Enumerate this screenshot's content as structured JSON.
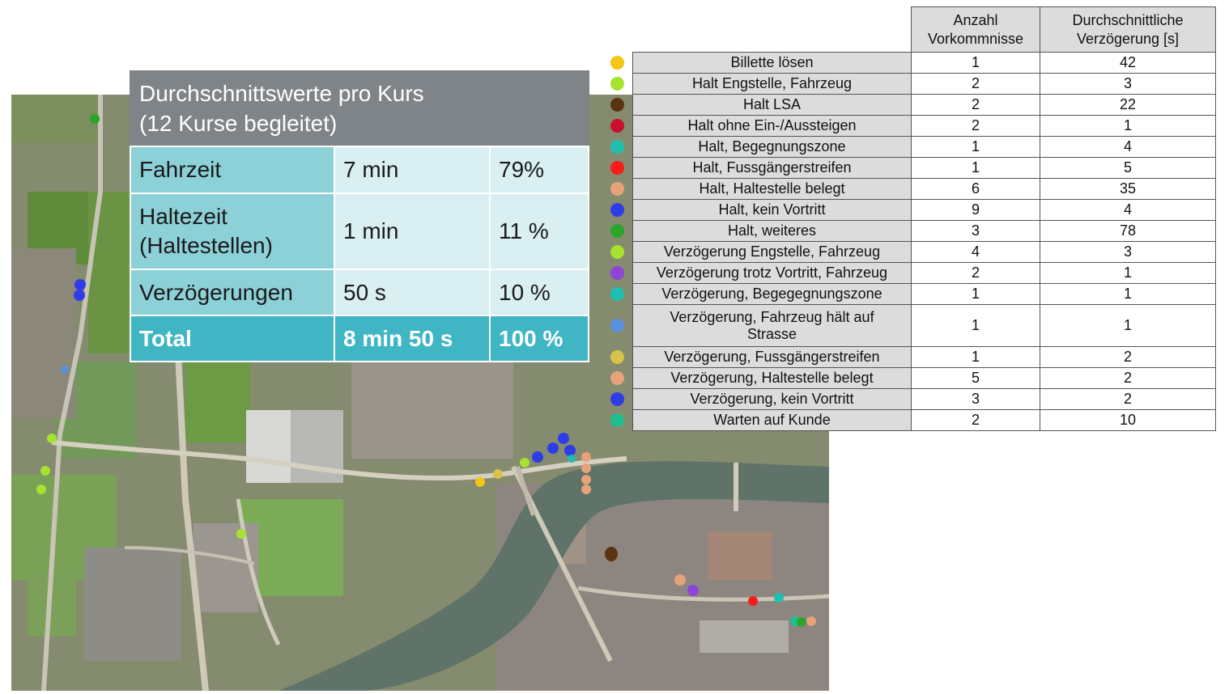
{
  "summary": {
    "title_line1": "Durchschnittswerte pro Kurs",
    "title_line2": "(12 Kurse begleitet)",
    "rows": [
      {
        "label": "Fahrzeit",
        "time": "7 min",
        "share": "79%"
      },
      {
        "label_line1": "Haltezeit",
        "label_line2": "(Haltestellen)",
        "time": "1 min",
        "share": "11 %"
      },
      {
        "label": "Verzögerungen",
        "time": "50 s",
        "share": "10 %"
      }
    ],
    "total": {
      "label": "Total",
      "time": "8 min 50 s",
      "share": "100 %"
    }
  },
  "incident_table": {
    "header_count_line1": "Anzahl",
    "header_count_line2": "Vorkommnisse",
    "header_delay_line1": "Durchschnittliche",
    "header_delay_line2": "Verzögerung [s]",
    "rows": [
      {
        "name": "Billette lösen",
        "count": "1",
        "delay": "42",
        "color": "#f5c518"
      },
      {
        "name": "Halt Engstelle, Fahrzeug",
        "count": "2",
        "delay": "3",
        "color": "#a6e22e"
      },
      {
        "name": "Halt LSA",
        "count": "2",
        "delay": "22",
        "color": "#5c3310"
      },
      {
        "name": "Halt ohne Ein-/Aussteigen",
        "count": "2",
        "delay": "1",
        "color": "#c8102e"
      },
      {
        "name": "Halt, Begegnungszone",
        "count": "1",
        "delay": "4",
        "color": "#1fbfb0"
      },
      {
        "name": "Halt, Fussgängerstreifen",
        "count": "1",
        "delay": "5",
        "color": "#ff1a1a"
      },
      {
        "name": "Halt, Haltestelle belegt",
        "count": "6",
        "delay": "35",
        "color": "#e6a27a"
      },
      {
        "name": "Halt, kein Vortritt",
        "count": "9",
        "delay": "4",
        "color": "#2f3de8"
      },
      {
        "name": "Halt, weiteres",
        "count": "3",
        "delay": "78",
        "color": "#2aa52a"
      },
      {
        "name": "Verzögerung Engstelle, Fahrzeug",
        "count": "4",
        "delay": "3",
        "color": "#a6e22e"
      },
      {
        "name": "Verzögerung trotz Vortritt, Fahrzeug",
        "count": "2",
        "delay": "1",
        "color": "#8e44d6"
      },
      {
        "name": "Verzögerung, Begegegnungszone",
        "count": "1",
        "delay": "1",
        "color": "#1fbfb0"
      },
      {
        "name_line1": "Verzögerung, Fahrzeug hält auf",
        "name_line2": "Strasse",
        "count": "1",
        "delay": "1",
        "color": "#5b8fe0"
      },
      {
        "name": "Verzögerung, Fussgängerstreifen",
        "count": "1",
        "delay": "2",
        "color": "#d8c24a"
      },
      {
        "name": "Verzögerung, Haltestelle belegt",
        "count": "5",
        "delay": "2",
        "color": "#e6a27a"
      },
      {
        "name": "Verzögerung, kein Vortritt",
        "count": "3",
        "delay": "2",
        "color": "#2f3de8"
      },
      {
        "name": "Warten auf Kunde",
        "count": "2",
        "delay": "10",
        "color": "#1fbf8f"
      }
    ]
  }
}
